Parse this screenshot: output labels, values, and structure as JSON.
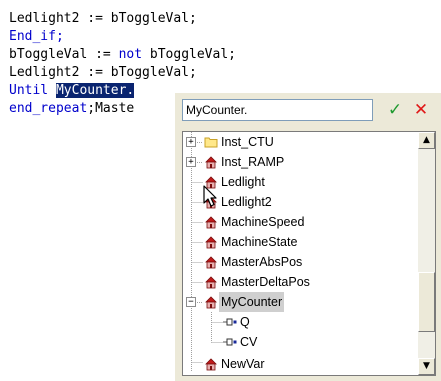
{
  "code": {
    "line1": "Ledlight2 := bToggleVal;",
    "line2": "End_if;",
    "line3_a": "bToggleVal := ",
    "line3_kw": "not",
    "line3_b": " bToggleVal;",
    "line4": "Ledlight2 := bToggleVal;",
    "line5_kw": "Until ",
    "line5_sel": "MyCounter.",
    "line6_kw": "end_repeat",
    "line6_rest": ";Maste"
  },
  "popup": {
    "filter_value": "MyCounter.",
    "ok_glyph": "✓",
    "cancel_glyph": "✕",
    "tree_items": [
      {
        "label": "Inst_CTU",
        "expander": "+"
      },
      {
        "label": "Inst_RAMP",
        "expander": "+"
      },
      {
        "label": "Ledlight"
      },
      {
        "label": "Ledlight2"
      },
      {
        "label": "MachineSpeed"
      },
      {
        "label": "MachineState"
      },
      {
        "label": "MasterAbsPos"
      },
      {
        "label": "MasterDeltaPos"
      },
      {
        "label": "MyCounter",
        "expander": "−",
        "selected": true
      },
      {
        "label": "Q"
      },
      {
        "label": "CV"
      },
      {
        "label": "NewVar"
      }
    ]
  },
  "icons": {
    "folder": "folder-icon",
    "variable": "variable-house-icon",
    "output": "output-pin-icon",
    "cursor": "mouse-cursor-icon"
  },
  "colors": {
    "keyword": "#0000cc",
    "selection": "#0a2470",
    "ok": "#1f9a2f",
    "cancel": "#e01818"
  }
}
